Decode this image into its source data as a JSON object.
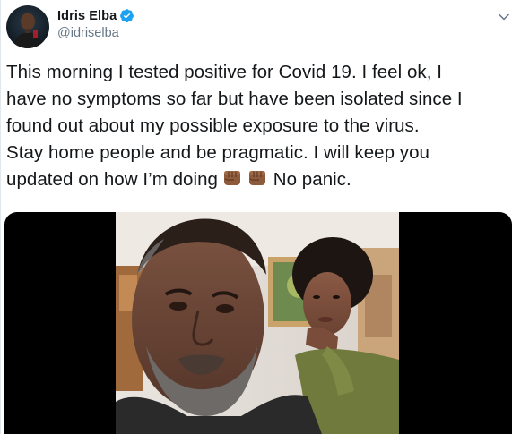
{
  "author": {
    "display_name": "Idris Elba",
    "handle": "@idriselba",
    "verified": true,
    "avatar_icon": "profile-photo"
  },
  "tweet": {
    "lines": [
      "This morning I tested positive for Covid 19. I feel ok, I",
      "have no symptoms so far but have been isolated since I",
      "found out about my possible exposure to the virus.",
      "Stay home people and be pragmatic. I will keep you",
      "updated on how I’m doing"
    ],
    "after_emoji_text": "No panic.",
    "emojis": [
      "oncoming-fist-medium-dark-skin",
      "oncoming-fist-medium-dark-skin"
    ]
  },
  "media": {
    "type": "video",
    "description_icon": "video-still-two-people"
  },
  "colors": {
    "text": "#14171a",
    "secondary": "#657786",
    "verified_blue": "#1da1f2",
    "media_background": "#000000"
  }
}
